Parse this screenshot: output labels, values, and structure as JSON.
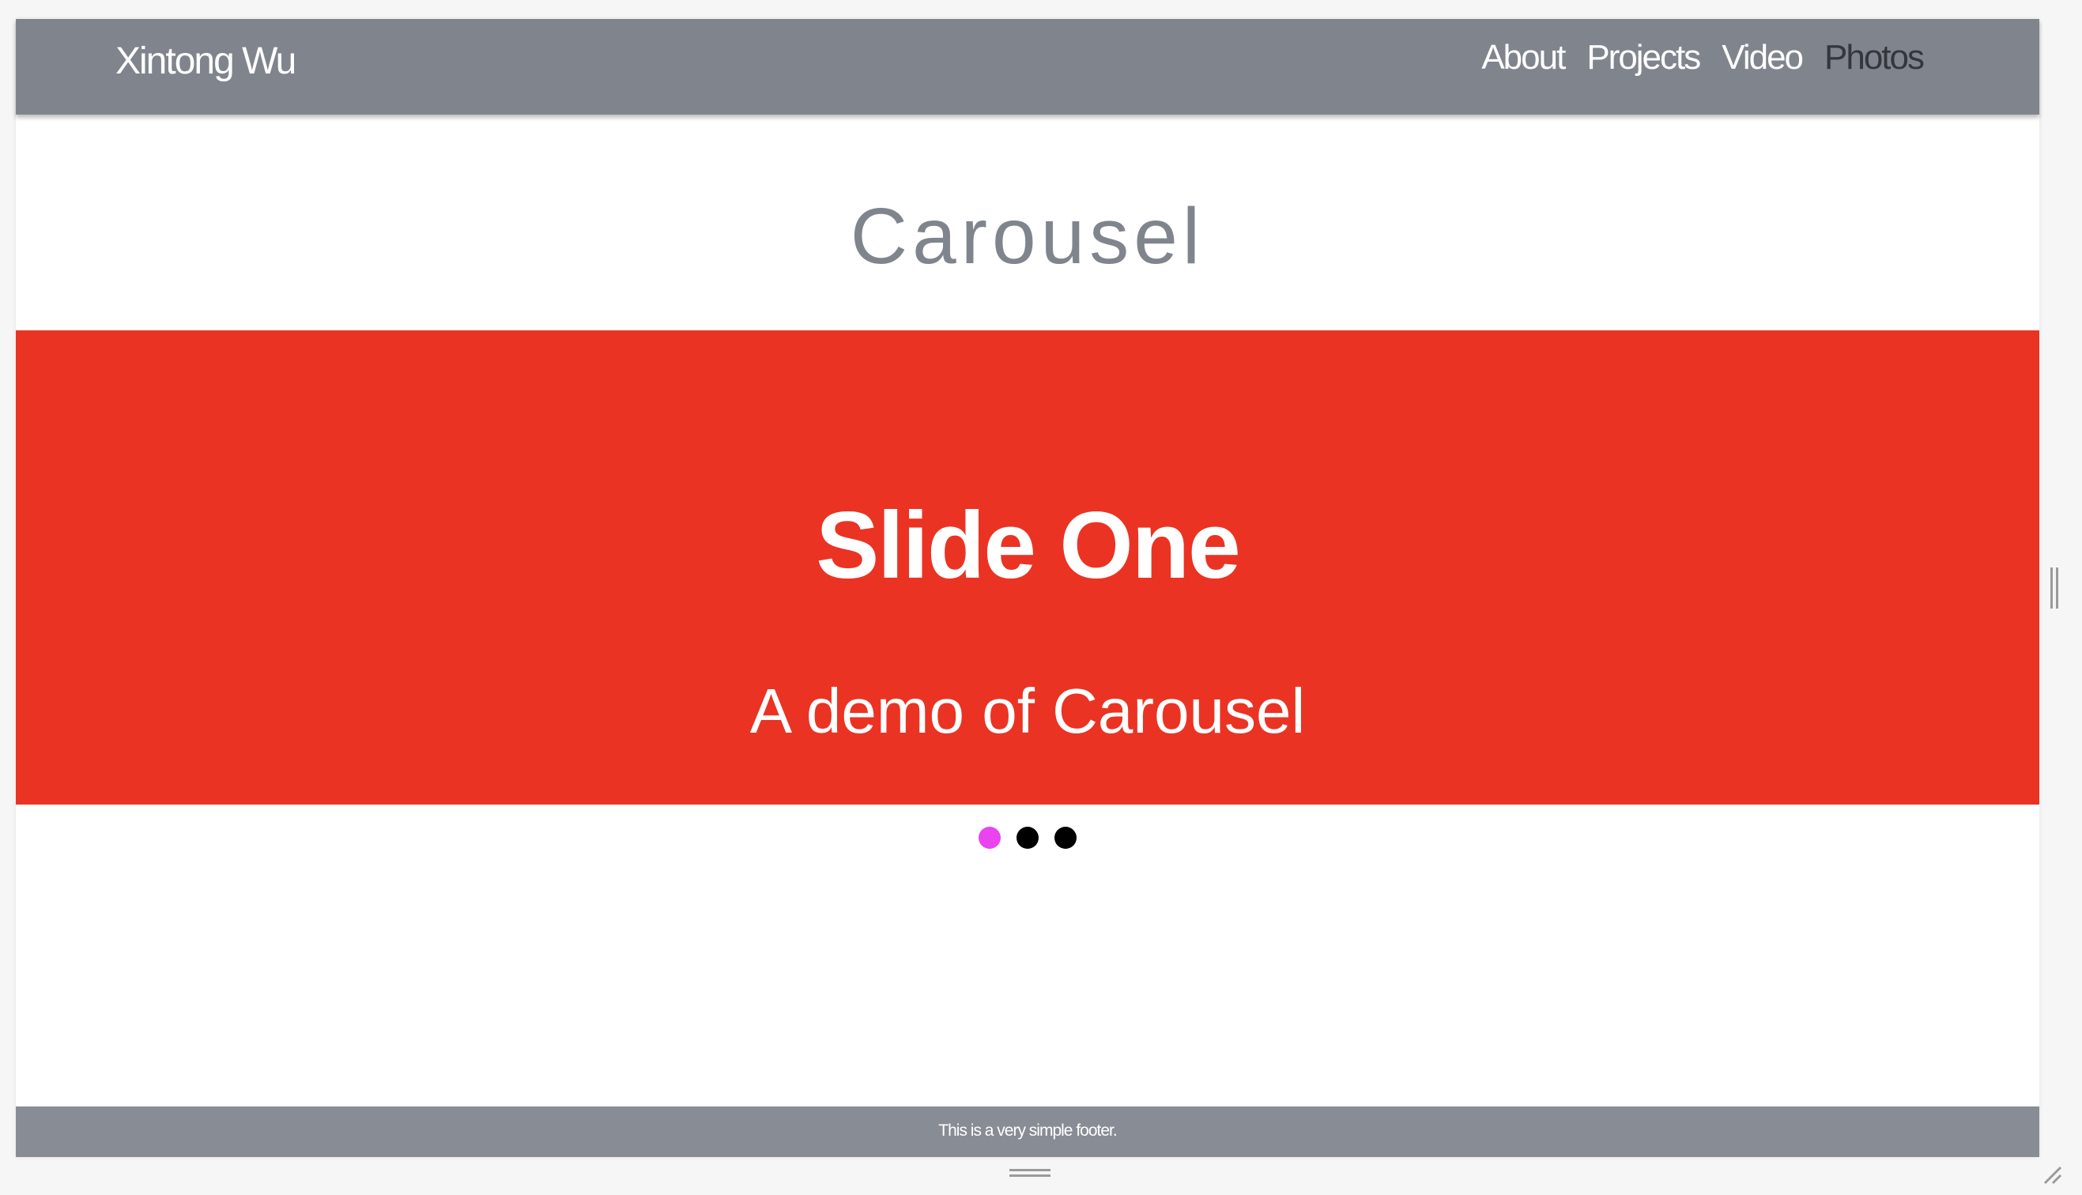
{
  "navbar": {
    "brand": "Xintong Wu",
    "links": [
      {
        "label": "About"
      },
      {
        "label": "Projects"
      },
      {
        "label": "Video"
      },
      {
        "label": "Photos"
      }
    ],
    "active_link": "Photos",
    "background": "#80858d"
  },
  "page": {
    "title": "Carousel"
  },
  "carousel": {
    "background": "#eb3323",
    "slide": {
      "heading": "Slide One",
      "subheading": "A demo of Carousel"
    },
    "slide_count": 3,
    "active_index": 0,
    "active_dot_color": "#e944f0",
    "inactive_dot_color": "#000000"
  },
  "footer": {
    "text": "This is a very simple footer.",
    "background": "#888c94"
  },
  "icons": {
    "bottom_resize_handle": "horizontal-grip-icon",
    "side_resize_handle": "vertical-grip-icon",
    "corner_resize": "resize-corner-icon"
  }
}
